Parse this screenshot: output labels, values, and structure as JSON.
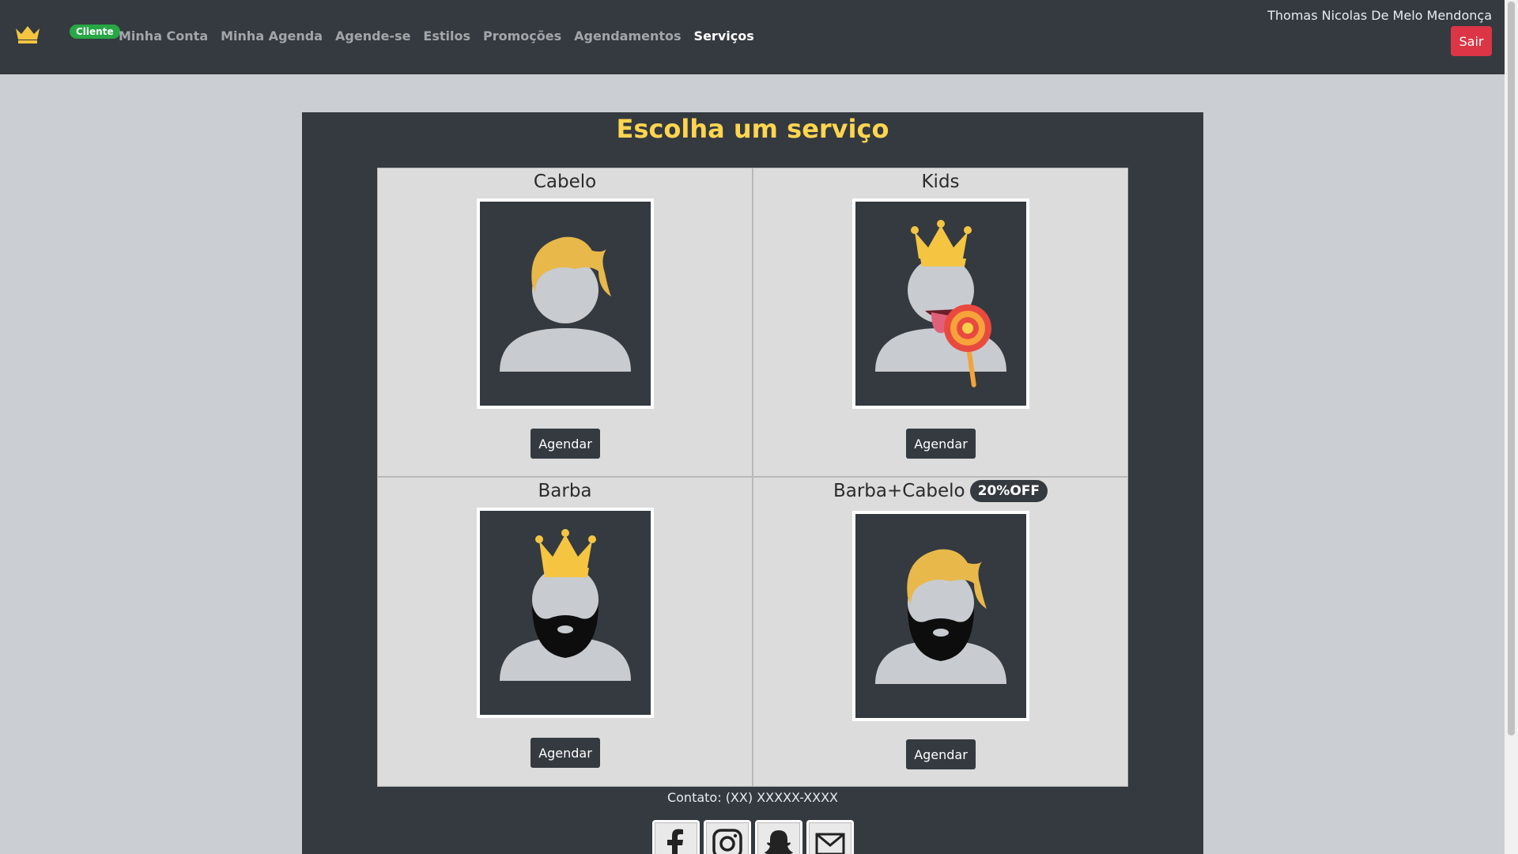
{
  "navbar": {
    "badge": "Cliente",
    "links": [
      "Minha Conta",
      "Minha Agenda",
      "Agende-se",
      "Estilos",
      "Promoções",
      "Agendamentos",
      "Serviços"
    ],
    "active_link": "Serviços",
    "user_name": "Thomas Nicolas De Melo Mendonça",
    "logout_label": "Sair"
  },
  "page": {
    "title": "Escolha um serviço"
  },
  "services": [
    {
      "name": "Cabelo",
      "button": "Agendar",
      "icon": "hair-avatar-icon"
    },
    {
      "name": "Kids",
      "button": "Agendar",
      "icon": "kid-crown-lollipop-icon"
    },
    {
      "name": "Barba",
      "button": "Agendar",
      "icon": "beard-crown-icon"
    },
    {
      "name": "Barba+Cabelo",
      "badge": "20%OFF",
      "button": "Agendar",
      "icon": "hair-beard-icon"
    }
  ],
  "footer": {
    "contact": "Contato: (XX) XXXXX-XXXX",
    "socials": [
      "facebook-icon",
      "instagram-icon",
      "snapchat-icon",
      "email-icon"
    ]
  },
  "colors": {
    "navbar": "#343a40",
    "accent_yellow": "#ffd54f",
    "badge_green": "#28a745",
    "logout_red": "#dc3545"
  }
}
